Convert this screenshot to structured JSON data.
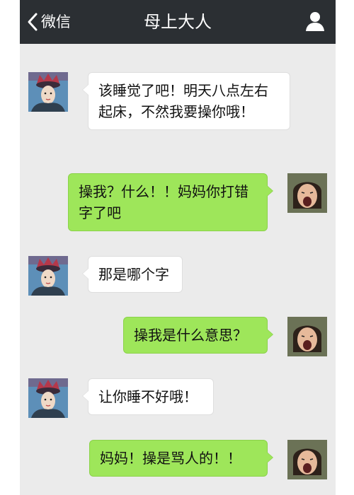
{
  "header": {
    "back_label": "微信",
    "back_icon": "chevron-left-icon",
    "title": "母上大人",
    "contact_icon": "person-icon"
  },
  "messages": [
    {
      "sender": "mom",
      "side": "left",
      "text": "该睡觉了吧！明天八点左右起床，不然我要操你哦！"
    },
    {
      "sender": "me",
      "side": "right",
      "text": "操我？什么！！妈妈你打错字了吧"
    },
    {
      "sender": "mom",
      "side": "left",
      "text": "那是哪个字"
    },
    {
      "sender": "me",
      "side": "right",
      "text": "操我是什么意思？"
    },
    {
      "sender": "mom",
      "side": "left",
      "text": "让你睡不好哦！"
    },
    {
      "sender": "me",
      "side": "right",
      "text": "妈妈！操是骂人的！！"
    }
  ],
  "colors": {
    "header_bg": "#2b2f33",
    "chat_bg": "#ebebeb",
    "incoming_bubble": "#ffffff",
    "outgoing_bubble": "#9ee65a"
  }
}
